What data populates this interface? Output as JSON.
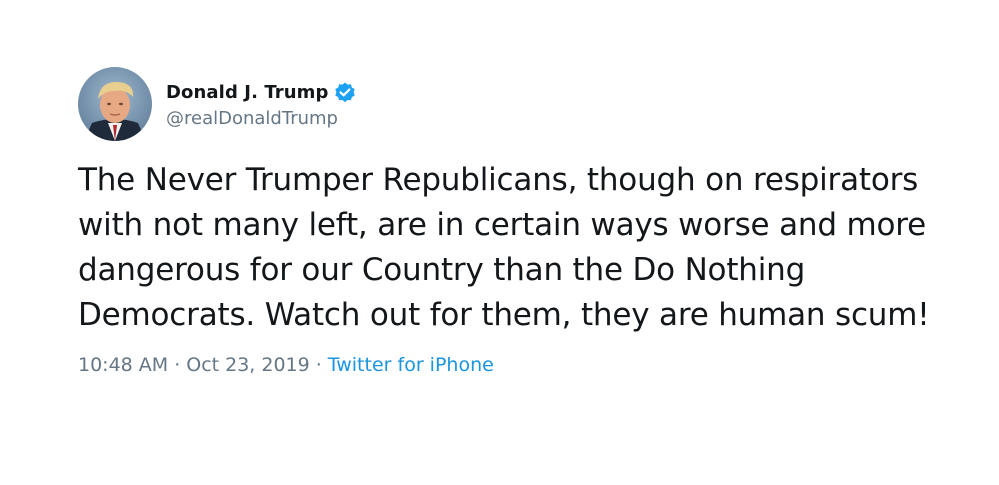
{
  "tweet": {
    "author": {
      "display_name": "Donald J. Trump",
      "handle": "@realDonaldTrump",
      "verified_icon": "verified-badge-icon",
      "avatar": "avatar-photo"
    },
    "text": "The Never Trumper Republicans, though on respirators\nwith not many left, are in certain ways worse and more\ndangerous for our Country than the Do Nothing\nDemocrats. Watch out for them, they are human scum!",
    "time": "10:48 AM",
    "separator": "·",
    "date": "Oct 23, 2019",
    "source": "Twitter for iPhone"
  },
  "colors": {
    "text": "#14171a",
    "secondary": "#657786",
    "link": "#1b95e0",
    "verified": "#1da1f2"
  }
}
